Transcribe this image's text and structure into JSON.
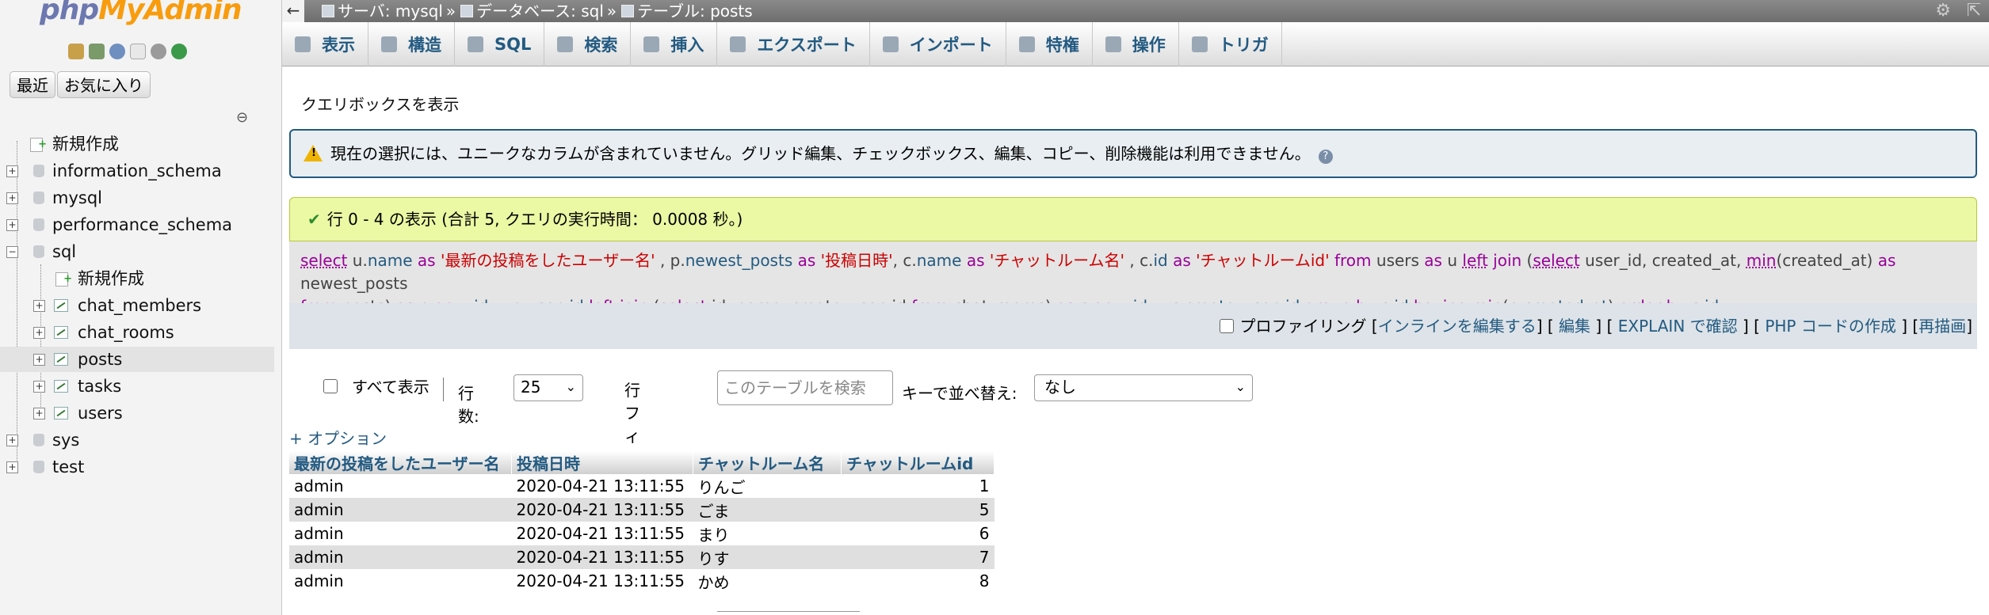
{
  "app": {
    "logo_php": "php",
    "logo_mya": "MyAdmin"
  },
  "nav": {
    "recent_label": "最近",
    "favorites_label": "お気に入り",
    "tree": [
      {
        "label": "新規作成",
        "kind": "new"
      },
      {
        "label": "information_schema",
        "kind": "db"
      },
      {
        "label": "mysql",
        "kind": "db"
      },
      {
        "label": "performance_schema",
        "kind": "db"
      },
      {
        "label": "sql",
        "kind": "db-open"
      },
      {
        "label": "新規作成",
        "kind": "new-child"
      },
      {
        "label": "chat_members",
        "kind": "table"
      },
      {
        "label": "chat_rooms",
        "kind": "table"
      },
      {
        "label": "posts",
        "kind": "table-selected"
      },
      {
        "label": "tasks",
        "kind": "table"
      },
      {
        "label": "users",
        "kind": "table"
      },
      {
        "label": "sys",
        "kind": "db"
      },
      {
        "label": "test",
        "kind": "db"
      }
    ]
  },
  "breadcrumb": {
    "server": "サーバ: mysql",
    "database": "データベース: sql",
    "table": "テーブル: posts",
    "sep": "»"
  },
  "tabs": [
    {
      "label": "表示",
      "icon": "browse-icon"
    },
    {
      "label": "構造",
      "icon": "structure-icon"
    },
    {
      "label": "SQL",
      "icon": "sql-icon"
    },
    {
      "label": "検索",
      "icon": "search-icon"
    },
    {
      "label": "挿入",
      "icon": "insert-icon"
    },
    {
      "label": "エクスポート",
      "icon": "export-icon"
    },
    {
      "label": "インポート",
      "icon": "import-icon"
    },
    {
      "label": "特権",
      "icon": "privileges-icon"
    },
    {
      "label": "操作",
      "icon": "operations-icon"
    },
    {
      "label": "トリガ",
      "icon": "triggers-icon"
    }
  ],
  "main": {
    "querybox_link": "クエリボックスを表示",
    "notice": "現在の選択には、ユニークなカラムが含まれていません。グリッド編集、チェックボックス、編集、コピー、削除機能は利用できません。",
    "success": "行 0 - 4 の表示 (合計 5, クエリの実行時間： 0.0008 秒。)",
    "sql_tools": {
      "profiling": "プロファイリング",
      "inline_edit": "インラインを編集する",
      "edit": "編集",
      "explain": "EXPLAIN で確認",
      "php_code": "PHP コードの作成",
      "refresh": "再描画"
    },
    "navrow": {
      "show_all": "すべて表示",
      "rows_label": "行数:",
      "rows_value": "25",
      "filter_label": "行フィルタ:",
      "filter_placeholder": "このテーブルを検索",
      "sortkey_label": "キーで並べ替え:",
      "sortkey_value": "なし"
    },
    "options_link": "+ オプション"
  },
  "results": {
    "columns": [
      "最新の投稿をしたユーザー名",
      "投稿日時",
      "チャットルーム名",
      "チャットルームid"
    ],
    "rows": [
      [
        "admin",
        "2020-04-21 13:11:55",
        "りんご",
        "1"
      ],
      [
        "admin",
        "2020-04-21 13:11:55",
        "ごま",
        "5"
      ],
      [
        "admin",
        "2020-04-21 13:11:55",
        "まり",
        "6"
      ],
      [
        "admin",
        "2020-04-21 13:11:55",
        "りす",
        "7"
      ],
      [
        "admin",
        "2020-04-21 13:11:55",
        "かめ",
        "8"
      ]
    ]
  },
  "colors": {
    "accent": "#235a81",
    "success_bg": "#ebf8a4",
    "notice_bg": "#e8eef1",
    "sql_keyword": "#990099",
    "sql_string": "#cc0000"
  }
}
